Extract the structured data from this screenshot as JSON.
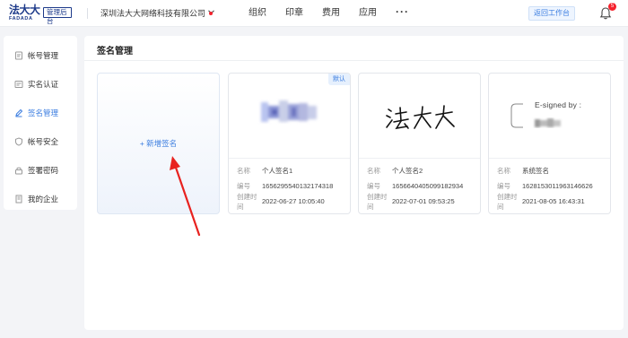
{
  "header": {
    "logo_cn": "法大大",
    "logo_en": "FADADA",
    "logo_badge": "管理后台",
    "company": "深圳法大大网络科技有限公司",
    "nav": [
      "组织",
      "印章",
      "费用",
      "应用"
    ],
    "more": "···",
    "back_button": "返回工作台",
    "notification_count": "5",
    "colors": {
      "brand": "#1d3a8a",
      "accent": "#3b7de0",
      "alert": "#f5222d"
    }
  },
  "sidebar": {
    "items": [
      {
        "label": "帐号管理",
        "icon": "account-icon",
        "active": false
      },
      {
        "label": "实名认证",
        "icon": "id-card-icon",
        "active": false
      },
      {
        "label": "签名管理",
        "icon": "pen-icon",
        "active": true
      },
      {
        "label": "帐号安全",
        "icon": "shield-icon",
        "active": false
      },
      {
        "label": "签署密码",
        "icon": "lock-icon",
        "active": false
      },
      {
        "label": "我的企业",
        "icon": "building-icon",
        "active": false
      }
    ]
  },
  "main": {
    "title": "签名管理",
    "add_label": "+ 新增签名",
    "labels": {
      "name": "名称",
      "id": "编号",
      "created": "创建时间"
    },
    "default_tag": "默认",
    "signatures": [
      {
        "name": "个人签名1",
        "id": "1656295540132174318",
        "created": "2022-06-27 10:05:40",
        "default": true,
        "image": "blurred-signature"
      },
      {
        "name": "个人签名2",
        "id": "1656640405099182934",
        "created": "2022-07-01 09:53:25",
        "default": false,
        "image": "handwritten-signature"
      },
      {
        "name": "系统签名",
        "id": "1628153011963146626",
        "created": "2021-08-05 16:43:31",
        "default": false,
        "image": "e-signed-stamp",
        "stamp_text": "E-signed by :"
      }
    ],
    "handwriting": "法大大"
  }
}
